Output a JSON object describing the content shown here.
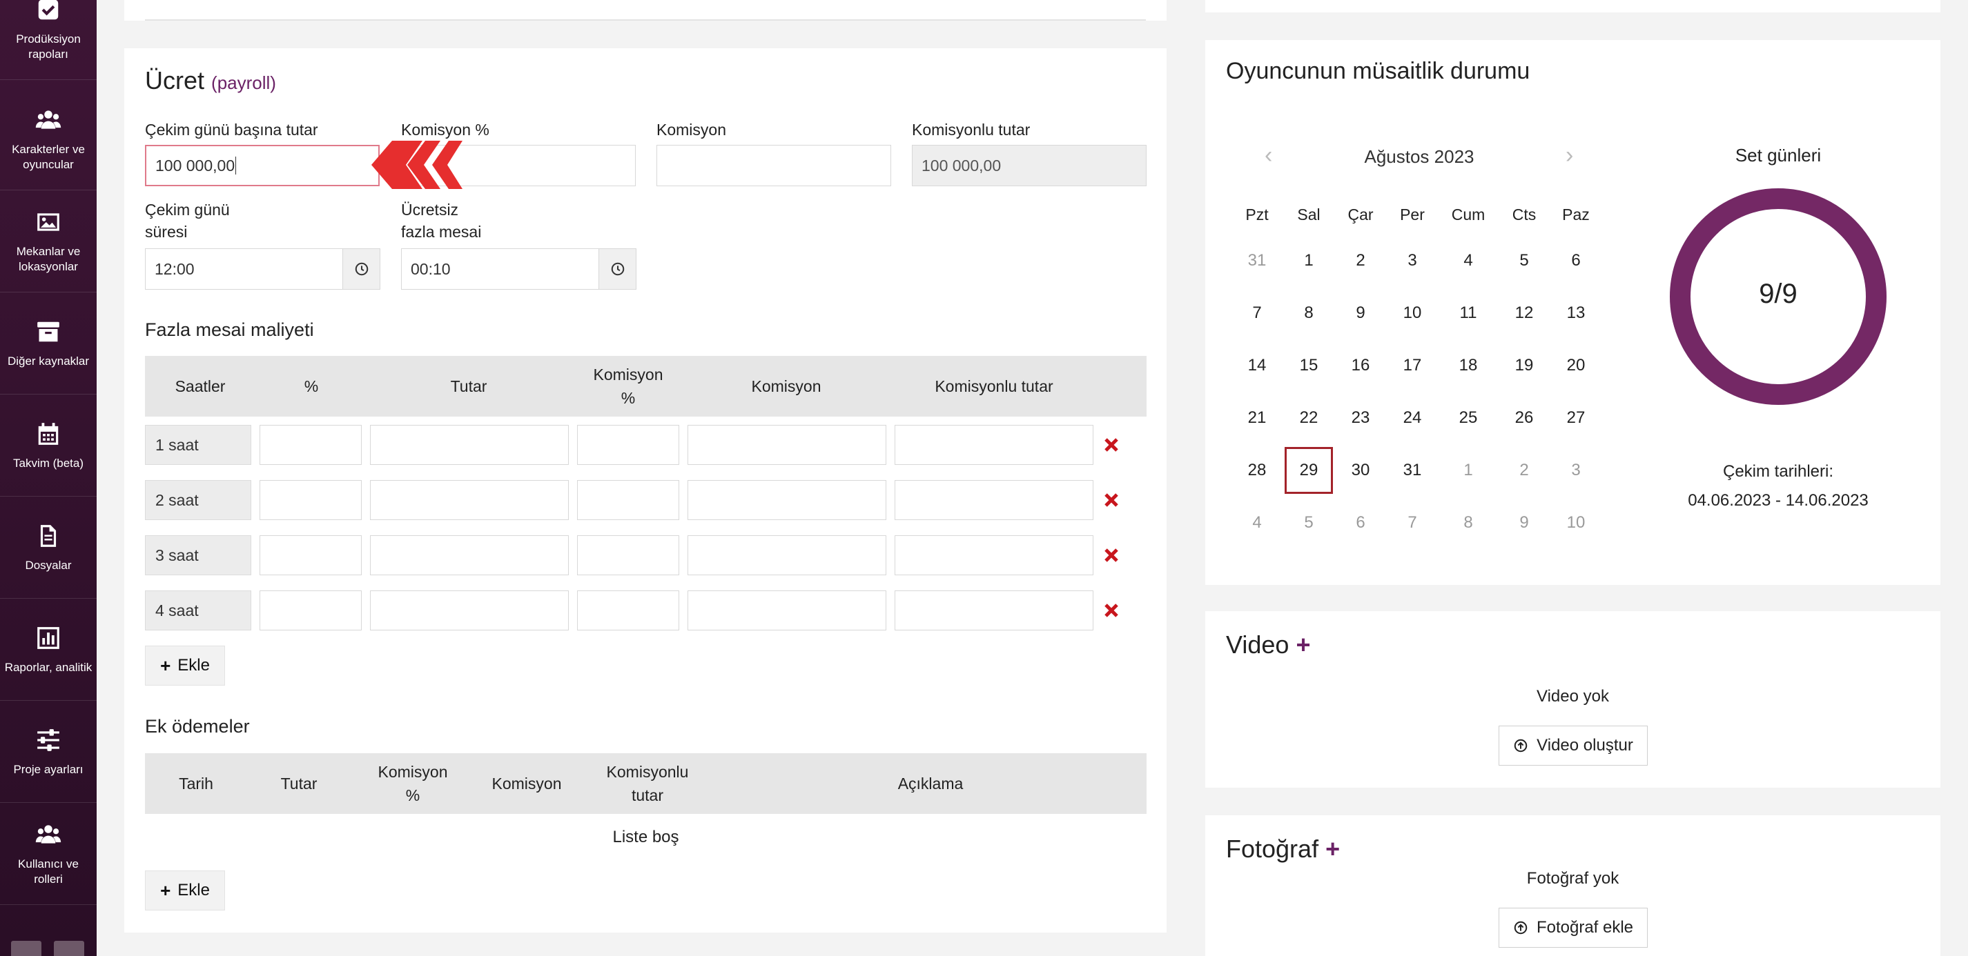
{
  "sidebar": {
    "items": [
      {
        "label": "Prodüksiyon\nrapoları",
        "icon": "checkbox-icon"
      },
      {
        "label": "Karakterler ve\noyuncular",
        "icon": "users-icon"
      },
      {
        "label": "Mekanlar ve\nlokasyonlar",
        "icon": "image-icon"
      },
      {
        "label": "Diğer kaynaklar",
        "icon": "archive-icon"
      },
      {
        "label": "Takvim (beta)",
        "icon": "calendar-icon"
      },
      {
        "label": "Dosyalar",
        "icon": "file-icon"
      },
      {
        "label": "Raporlar, analitik",
        "icon": "chart-icon"
      },
      {
        "label": "Proje ayarları",
        "icon": "sliders-icon"
      },
      {
        "label": "Kullanıcı ve\nrolleri",
        "icon": "users-icon"
      }
    ]
  },
  "payroll": {
    "title": "Ücret",
    "subtitle": "(payroll)",
    "per_day_label": "Çekim günü başına tutar",
    "per_day_value": "100 000,00",
    "commission_pct_label": "Komisyon %",
    "commission_label": "Komisyon",
    "with_commission_label": "Komisyonlu tutar",
    "with_commission_value": "100 000,00",
    "shift_length_label": "Çekim günü\nsüresi",
    "shift_length_value": "12:00",
    "free_overtime_label": "Ücretsiz\nfazla mesai",
    "free_overtime_value": "00:10"
  },
  "overtime": {
    "title": "Fazla mesai maliyeti",
    "headers": [
      "Saatler",
      "%",
      "Tutar",
      "Komisyon\n%",
      "Komisyon",
      "Komisyonlu tutar"
    ],
    "rows": [
      "1 saat",
      "2 saat",
      "3 saat",
      "4 saat"
    ],
    "add_label": "Ekle"
  },
  "extra_payments": {
    "title": "Ek ödemeler",
    "headers": [
      "Tarih",
      "Tutar",
      "Komisyon\n%",
      "Komisyon",
      "Komisyonlu\ntutar",
      "Açıklama"
    ],
    "empty_text": "Liste boş",
    "add_label": "Ekle"
  },
  "availability": {
    "title": "Oyuncunun müsaitlik durumu",
    "month": "Ağustos 2023",
    "weekdays": [
      "Pzt",
      "Sal",
      "Çar",
      "Per",
      "Cum",
      "Cts",
      "Paz"
    ],
    "weeks": [
      [
        "31",
        "1",
        "2",
        "3",
        "4",
        "5",
        "6"
      ],
      [
        "7",
        "8",
        "9",
        "10",
        "11",
        "12",
        "13"
      ],
      [
        "14",
        "15",
        "16",
        "17",
        "18",
        "19",
        "20"
      ],
      [
        "21",
        "22",
        "23",
        "24",
        "25",
        "26",
        "27"
      ],
      [
        "28",
        "29",
        "30",
        "31",
        "1",
        "2",
        "3"
      ],
      [
        "4",
        "5",
        "6",
        "7",
        "8",
        "9",
        "10"
      ]
    ],
    "set_days_label": "Set günleri",
    "set_days_value": "9/9",
    "set_days_fraction": 1.0,
    "shoot_dates_label": "Çekim tarihleri:",
    "shoot_dates_value": "04.06.2023 - 14.06.2023",
    "ring_color": "#742865"
  },
  "video": {
    "title": "Video",
    "empty_text": "Video yok",
    "button_label": "Video oluştur"
  },
  "photo": {
    "title": "Fotoğraf",
    "empty_text": "Fotoğraf yok",
    "button_label": "Fotoğraf ekle"
  }
}
